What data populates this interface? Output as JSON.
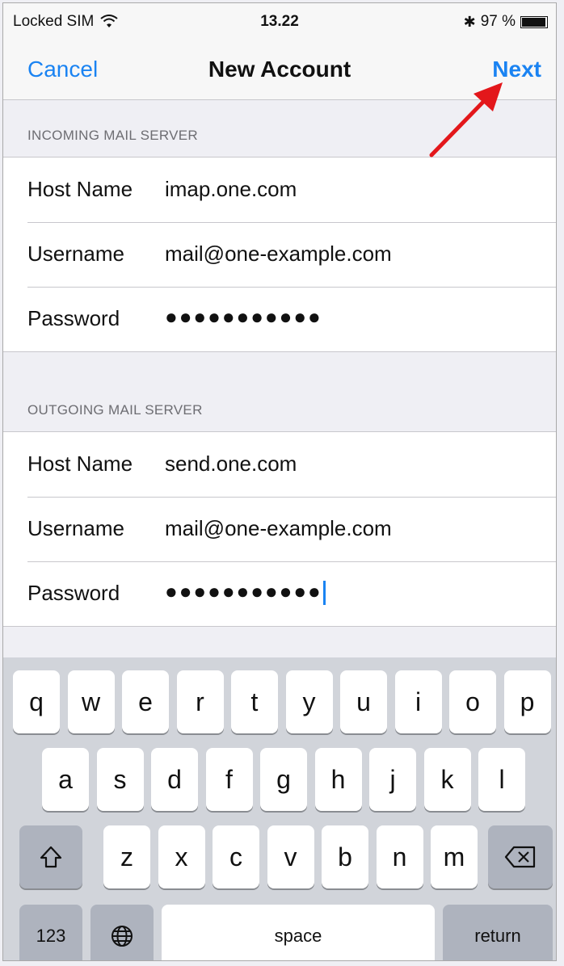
{
  "status_bar": {
    "carrier": "Locked SIM",
    "time": "13.22",
    "battery": "97 %",
    "battery_level": 0.97,
    "icons": [
      "wifi-icon",
      "bluetooth-icon",
      "battery-icon"
    ]
  },
  "nav": {
    "cancel": "Cancel",
    "title": "New Account",
    "next": "Next"
  },
  "incoming": {
    "header": "INCOMING MAIL SERVER",
    "rows": [
      {
        "label": "Host Name",
        "value": "imap.one.com"
      },
      {
        "label": "Username",
        "value": "mail@one-example.com"
      },
      {
        "label": "Password",
        "value": "●●●●●●●●●●●"
      }
    ]
  },
  "outgoing": {
    "header": "OUTGOING MAIL SERVER",
    "rows": [
      {
        "label": "Host Name",
        "value": "send.one.com"
      },
      {
        "label": "Username",
        "value": "mail@one-example.com"
      },
      {
        "label": "Password",
        "value": "●●●●●●●●●●●"
      }
    ]
  },
  "keyboard": {
    "row1": [
      "q",
      "w",
      "e",
      "r",
      "t",
      "y",
      "u",
      "i",
      "o",
      "p"
    ],
    "row2": [
      "a",
      "s",
      "d",
      "f",
      "g",
      "h",
      "j",
      "k",
      "l"
    ],
    "row3": [
      "z",
      "x",
      "c",
      "v",
      "b",
      "n",
      "m"
    ],
    "shift_icon": "shift-icon",
    "delete_icon": "delete-icon",
    "globe_icon": "globe-icon",
    "numbers": "123",
    "space": "space",
    "return": "return"
  },
  "colors": {
    "accent": "#1a83f2",
    "arrow": "#e3171b"
  }
}
